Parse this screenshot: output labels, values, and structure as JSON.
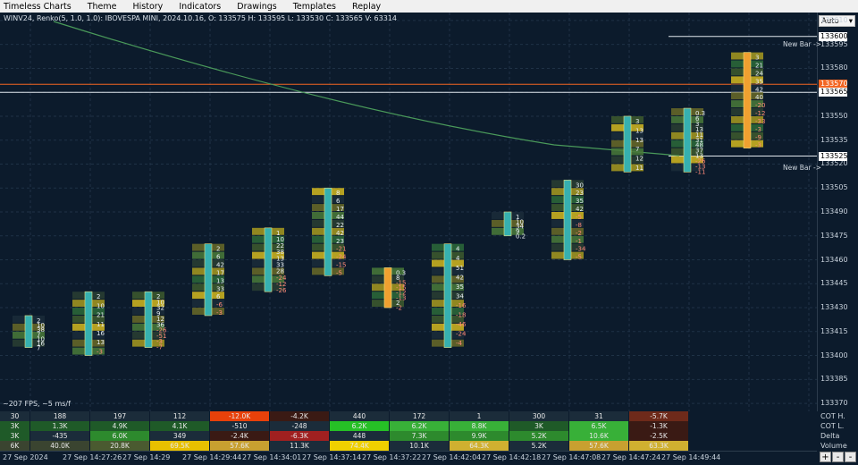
{
  "menu": [
    "Timeless Charts",
    "Theme",
    "History",
    "Indicators",
    "Drawings",
    "Templates",
    "Replay"
  ],
  "chart_info": "WINV24, Renko(5, 1.0, 1.0): IBOVESPA MINI, 2024.10.16, O: 133575 H: 133595 L: 133530 C: 133565 V: 63314",
  "fps": "~207 FPS, ~5 ms/f",
  "scale_mode": "Auto",
  "price_ticks": [
    "133610",
    "133595",
    "133580",
    "133565",
    "133550",
    "133535",
    "133520",
    "133505",
    "133490",
    "133475",
    "133460",
    "133445",
    "133430",
    "133415",
    "133400",
    "133385",
    "133370"
  ],
  "price_badges": [
    {
      "text": "133600",
      "bg": "#ffffff",
      "fg": "#000000"
    },
    {
      "text": "133570",
      "bg": "#f26522",
      "fg": "#ffffff"
    },
    {
      "text": "133565",
      "bg": "#ffffff",
      "fg": "#000000"
    },
    {
      "text": "133525",
      "bg": "#ffffff",
      "fg": "#000000"
    }
  ],
  "new_bar_labels": [
    "New Bar ->",
    "New Bar ->"
  ],
  "stat_labels": [
    "COT H.",
    "COT L.",
    "Delta",
    "Volume"
  ],
  "stats": {
    "cot_h": [
      "30",
      "188",
      "197",
      "112",
      "-12.0K",
      "-4.2K",
      "440",
      "172",
      "1",
      "300",
      "31",
      "-5.7K"
    ],
    "cot_l": [
      "3K",
      "1.3K",
      "4.9K",
      "4.1K",
      "-510",
      "-248",
      "6.2K",
      "6.2K",
      "8.8K",
      "3K",
      "6.5K",
      "-1.3K"
    ],
    "delta": [
      "3K",
      "-435",
      "6.0K",
      "349",
      "-2.4K",
      "-6.3K",
      "448",
      "7.3K",
      "9.9K",
      "5.2K",
      "10.6K",
      "-2.5K"
    ],
    "volume": [
      "6K",
      "40.0K",
      "20.8K",
      "69.5K",
      "57.6K",
      "11.3K",
      "74.4K",
      "10.1K",
      "64.3K",
      "5.2K",
      "57.6K",
      "63.3K"
    ]
  },
  "stat_colors": {
    "cot_h": [
      "#1b2c3a",
      "#1b2c3a",
      "#1b2c3a",
      "#1b2c3a",
      "#e8410a",
      "#3a1a14",
      "#1b2c3a",
      "#1b2c3a",
      "#1b2c3a",
      "#1b2c3a",
      "#1b2c3a",
      "#6e2a1a"
    ],
    "cot_l": [
      "#1f5a28",
      "#1f5a28",
      "#1f5a28",
      "#1f5a28",
      "#1b2c3a",
      "#1b2c3a",
      "#26c026",
      "#38b038",
      "#38b038",
      "#1f5a28",
      "#38b038",
      "#3a1a14"
    ],
    "delta": [
      "#1f5a28",
      "#1b2c3a",
      "#2d8a2d",
      "#1b2c3a",
      "#3a1a14",
      "#a02020",
      "#1b2c3a",
      "#2d8a2d",
      "#2d8a2d",
      "#2d8a2d",
      "#38b038",
      "#3a1a14"
    ],
    "volume": [
      "#3a4430",
      "#3a4430",
      "#4a5a30",
      "#e8c000",
      "#c8a030",
      "#1b2c3a",
      "#f0d000",
      "#1b2c3a",
      "#d0b030",
      "#1b2c3a",
      "#c8a030",
      "#d0b030"
    ]
  },
  "time_labels": [
    "27 Sep 2024",
    "27 Sep 14:27:26",
    "27 Sep 14:29",
    "27 Sep 14:29:44",
    "27 Sep 14:34:01",
    "27 Sep 14:37:14",
    "27 Sep 14:37:22",
    "27 Sep 14:42:04",
    "27 Sep 14:42:18",
    "27 Sep 14:47:08",
    "27 Sep 14:47:24",
    "27 Sep 14:49:44"
  ],
  "zoom_buttons": [
    "+",
    "-",
    "-"
  ],
  "chart_data": {
    "type": "renko-footprint",
    "brick_size": 5,
    "y_range": [
      133365,
      133615
    ],
    "hlines": [
      {
        "price": 133600,
        "color": "#e0e6ec"
      },
      {
        "price": 133570,
        "color": "#f26522"
      },
      {
        "price": 133565,
        "color": "#e0e6ec"
      },
      {
        "price": 133525,
        "color": "#e0e6ec"
      }
    ],
    "bars": [
      {
        "lo": 133405,
        "hi": 133425,
        "dir": "up",
        "nums": [
          "2",
          "10",
          "38",
          "7",
          "10",
          "16",
          "7"
        ]
      },
      {
        "lo": 133400,
        "hi": 133440,
        "dir": "up",
        "nums": [
          "2",
          "10",
          "21",
          "11",
          "16",
          "13",
          "-3"
        ]
      },
      {
        "lo": 133405,
        "hi": 133440,
        "dir": "up",
        "nums": [
          "2",
          "10",
          "32",
          "9",
          "12",
          "36",
          "-26",
          "-51",
          "-3",
          "-7"
        ]
      },
      {
        "lo": 133425,
        "hi": 133470,
        "dir": "up",
        "nums": [
          "2",
          "6",
          "42",
          "17",
          "13",
          "33",
          "6",
          "-6",
          "-3"
        ]
      },
      {
        "lo": 133440,
        "hi": 133480,
        "dir": "up",
        "nums": [
          "1",
          "10",
          "22",
          "38",
          "13",
          "33",
          "28",
          "-24",
          "-12",
          "-26"
        ]
      },
      {
        "lo": 133450,
        "hi": 133505,
        "dir": "up",
        "nums": [
          "8",
          "6",
          "17",
          "44",
          "22",
          "42",
          "23",
          "-21",
          "-24",
          "-15",
          "-5"
        ]
      },
      {
        "lo": 133430,
        "hi": 133455,
        "dir": "down",
        "nums": [
          "0.3",
          "8",
          "-15",
          "-15",
          "-12",
          "-13",
          "2",
          "-2"
        ]
      },
      {
        "lo": 133405,
        "hi": 133470,
        "dir": "up",
        "nums": [
          "4",
          "4",
          "51",
          "42",
          "35",
          "34",
          "-16",
          "-18",
          "-46",
          "-24",
          "-4"
        ]
      },
      {
        "lo": 133475,
        "hi": 133490,
        "dir": "up",
        "nums": [
          "1",
          "10",
          "34",
          "9",
          "0.2"
        ]
      },
      {
        "lo": 133460,
        "hi": 133510,
        "dir": "up",
        "nums": [
          "30",
          "23",
          "35",
          "42",
          "-5",
          "-8",
          "-2",
          "-1",
          "-34",
          "-5"
        ]
      },
      {
        "lo": 133515,
        "hi": 133550,
        "dir": "up",
        "nums": [
          "3",
          "13",
          "13",
          "7",
          "12",
          "11"
        ]
      },
      {
        "lo": 133515,
        "hi": 133555,
        "dir": "up",
        "nums": [
          "0.3",
          "6",
          "3",
          "13",
          "11",
          "31",
          "48",
          "37",
          "13",
          "-26",
          "-13",
          "-11"
        ]
      },
      {
        "lo": 133530,
        "hi": 133590,
        "dir": "up",
        "nums": [
          "3",
          "21",
          "24",
          "35",
          "42",
          "40",
          "-20",
          "-12",
          "-33",
          "-3",
          "-9",
          "-3"
        ]
      }
    ]
  }
}
